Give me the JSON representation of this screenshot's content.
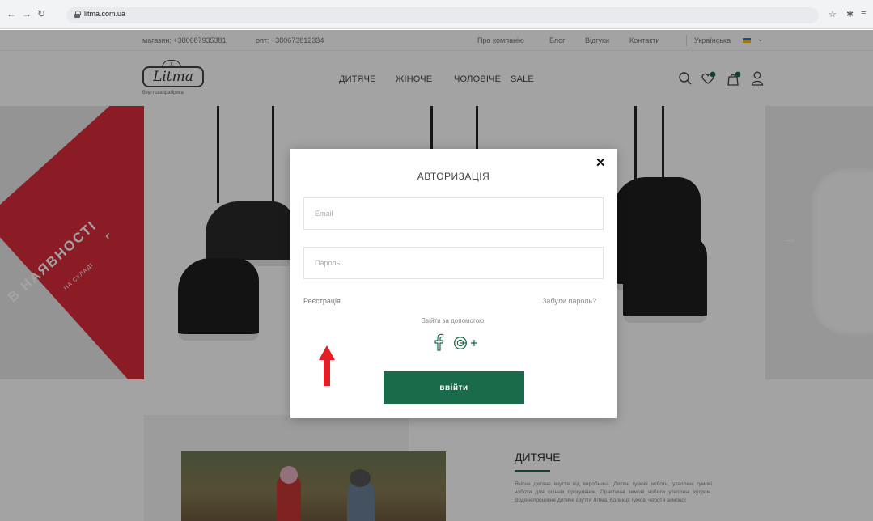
{
  "browser": {
    "url": "litma.com.ua",
    "back_icon": "arrow-left-icon",
    "forward_icon": "arrow-right-icon",
    "reload_icon": "reload-icon"
  },
  "topbar": {
    "shop_phone": "магазин: +380687935381",
    "wholesale_phone": "опт: +380673812334",
    "links": [
      "Про компанію",
      "Блог",
      "Відгуки",
      "Контакти"
    ],
    "language": "Українська"
  },
  "header": {
    "logo_text": "Litma",
    "logo_sub": "Взуттєва фабрика",
    "menu": [
      "ДИТЯЧЕ",
      "ЖІНОЧЕ",
      "ЧОЛОВІЧЕ",
      "SALE"
    ]
  },
  "slider": {
    "banner_text": "В НАЯВНОСТІ",
    "banner_sub": "НА СКЛАДІ"
  },
  "category": {
    "title": "ДИТЯЧЕ",
    "text": "Якісне дитяче взуття від виробника. Дитячі гумові чоботи, утеплені гумові чоботи для осінніх прогулянок. Практичні зимові чоботи утеплені хутром. Водонепроникне дитяче взуття Літма. Колекції гумові чоботи зимової"
  },
  "modal": {
    "title": "АВТОРИЗАЦІЯ",
    "email_placeholder": "Email",
    "password_placeholder": "Пароль",
    "register_label": "Реєстрація",
    "forgot_label": "Забули пароль?",
    "social_label": "Ввійти за допомогою:",
    "login_label": "ввійти",
    "close_label": "✕"
  },
  "colors": {
    "accent_green": "#1a6b4a",
    "banner_red": "#d92b3a",
    "annotation_red": "#e31e24"
  }
}
